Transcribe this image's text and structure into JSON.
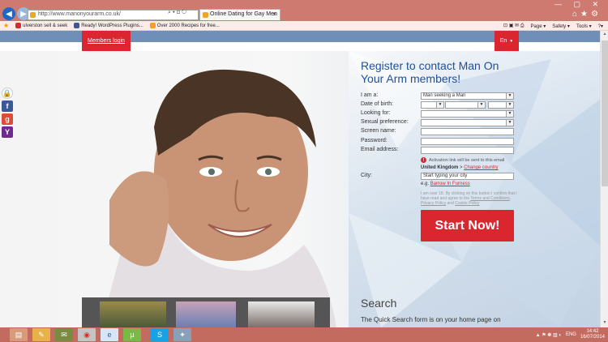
{
  "browser": {
    "url": "http://www.manonyourarm.co.uk/",
    "tab_title": "Online Dating for Gay Men",
    "favorites": [
      {
        "label": "ulverston sell & seek",
        "color": "#d0312d"
      },
      {
        "label": "Ready! WordPress Plugins...",
        "color": "#3b5998"
      },
      {
        "label": "Over 2000 Recipes for free...",
        "color": "#f4a020"
      }
    ],
    "commands": [
      "Page ▾",
      "Safety ▾",
      "Tools ▾"
    ]
  },
  "header": {
    "members_login": "Members login",
    "language": "En"
  },
  "form": {
    "title": "Register to contact Man On Your Arm members!",
    "labels": {
      "i_am": "I am a:",
      "dob": "Date of birth:",
      "looking": "Looking for:",
      "sexual": "Sexual preference:",
      "screen": "Screen name:",
      "password": "Password:",
      "email": "Email address:",
      "city": "City:"
    },
    "i_am_value": "Man seeking a Man",
    "activation_note": "Activation link will be sent to this email",
    "country": "United Kingdom",
    "change_country": "Change country",
    "city_placeholder": "Start typing your city",
    "eg_label": "e.g.",
    "eg_city": "Barrow In Furness",
    "terms_text": "I am over 18. By clicking on this button I confirm that I have read and agree to the",
    "terms_link": "Terms and Conditions",
    "privacy_link": "Privacy Policy",
    "and": "and",
    "cookie_link": "Cookie Policy",
    "submit": "Start Now!"
  },
  "search": {
    "title": "Search",
    "text": "The Quick Search form is on your home page on"
  },
  "taskbar": {
    "lang": "ENG",
    "time": "14:42",
    "date": "16/07/2014"
  }
}
